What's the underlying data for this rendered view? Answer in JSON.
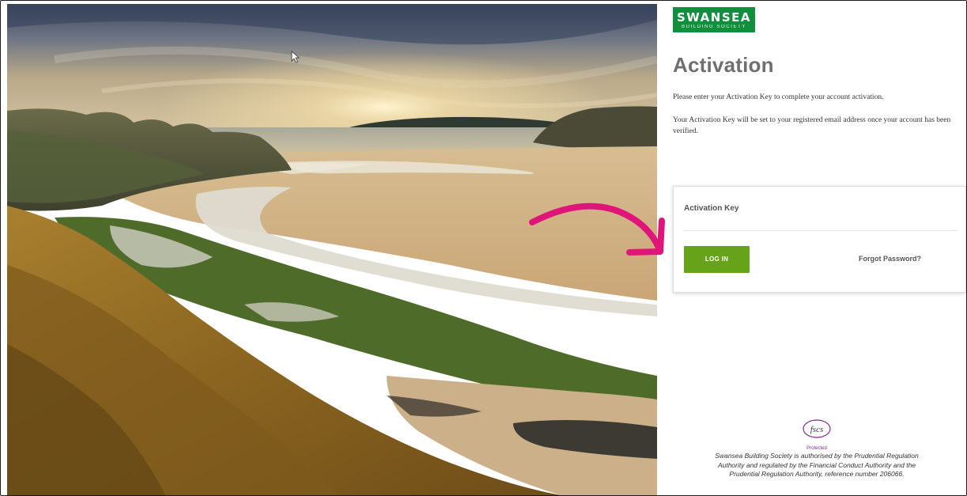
{
  "brand": {
    "name": "SWANSEA",
    "tagline": "BUILDING SOCIETY",
    "color": "#108f3d"
  },
  "page": {
    "title": "Activation",
    "intro": "Please enter your Activation Key to complete your account activation.",
    "note": "Your Activation Key will be set to your registered email address once your account has been verified."
  },
  "form": {
    "key_label": "Activation Key",
    "key_value": "",
    "login_label": "LOG IN",
    "login_color": "#66a31a",
    "forgot_label": "Forgot Password?"
  },
  "footer": {
    "fscs_logo_text": "fscs",
    "fscs_protected": "Protected",
    "regulatory_text": "Swansea Building Society is authorised by the Prudential Regulation Authority and regulated by the Financial Conduct Authority and the Prudential Regulation Authority, reference number 206066."
  },
  "annotation": {
    "arrow_color": "#e0157a"
  },
  "icons": {
    "cursor": "mouse-pointer-icon",
    "arrow": "curved-arrow-icon",
    "fscs": "fscs-logo-icon"
  }
}
